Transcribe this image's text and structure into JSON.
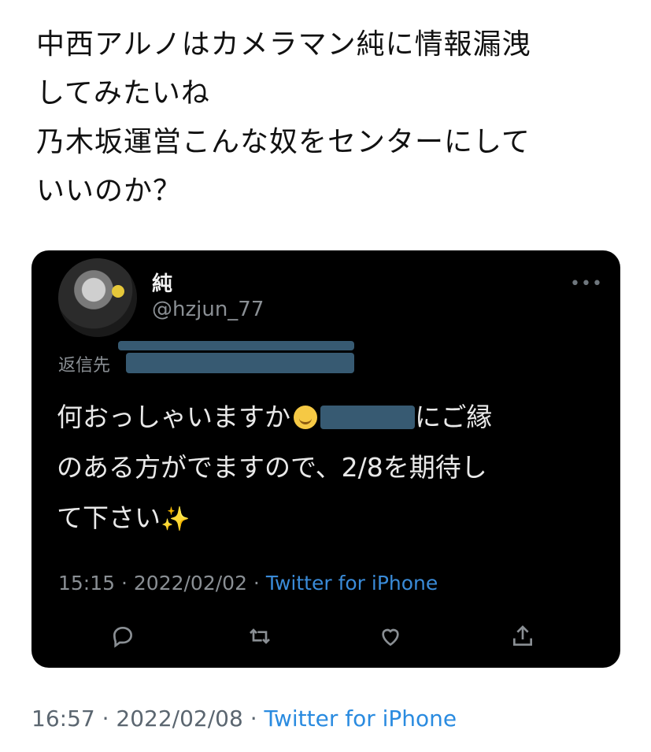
{
  "tweet": {
    "text_lines": [
      "中西アルノはカメラマン純に情報漏洩",
      "してみたいね",
      "乃木坂運営こんな奴をセンターにして",
      "いいのか？"
    ],
    "time": "16:57",
    "date": "2022/02/08",
    "source": "Twitter for iPhone"
  },
  "quoted": {
    "name": "純",
    "handle": "@hzjun_77",
    "reply_label": "返信先",
    "line1_a": "何おっしゃいますか",
    "line1_b": "にご縁",
    "line2": "のある方がでますので、2/8を期待し",
    "line3": "て下さい",
    "sparkle": "✨",
    "time": "15:15",
    "date": "2022/02/02",
    "source": "Twitter for iPhone"
  },
  "icons": [
    "more-icon",
    "reply-icon",
    "retweet-icon",
    "like-icon",
    "share-icon"
  ]
}
